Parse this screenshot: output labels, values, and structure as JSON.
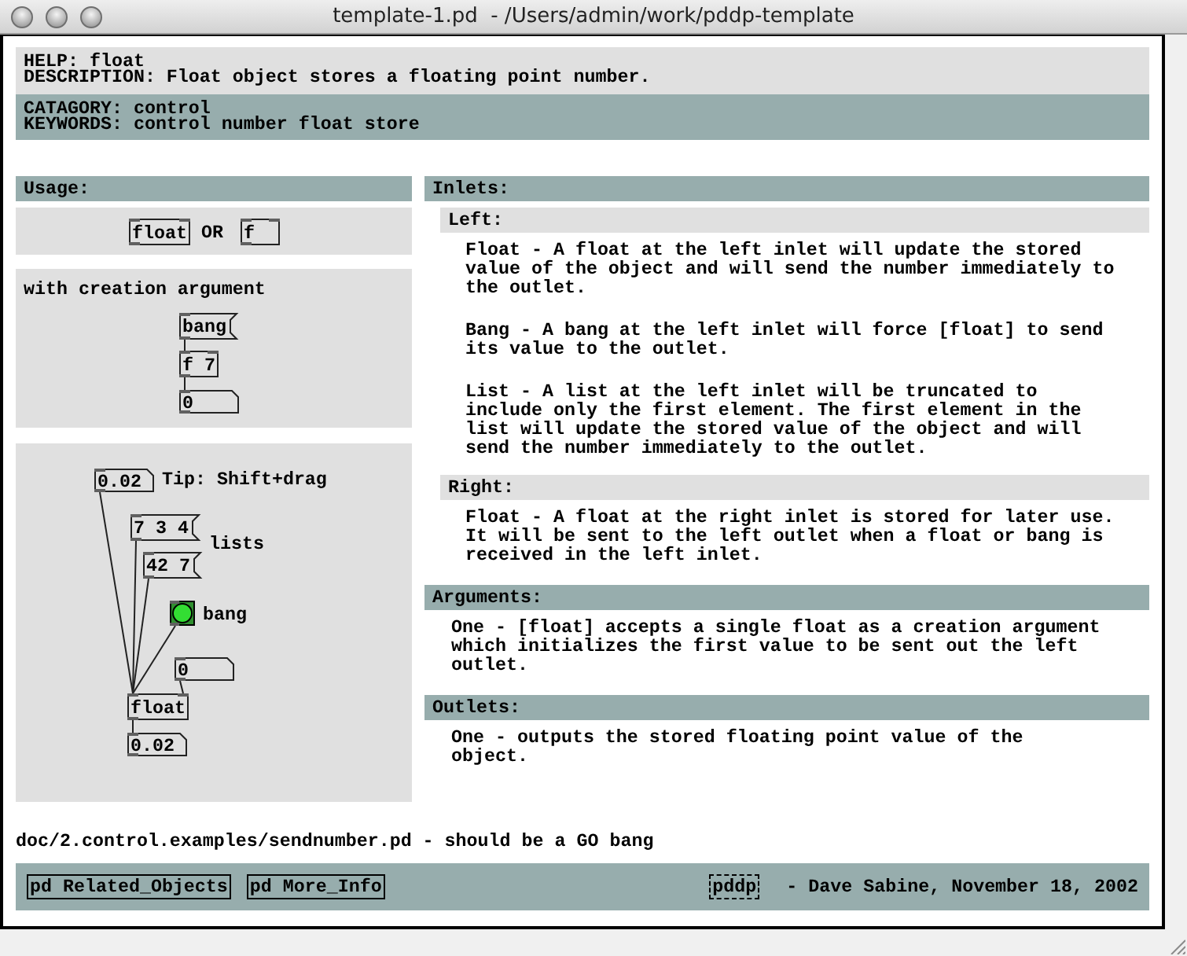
{
  "window": {
    "title": "template-1.pd  - /Users/admin/work/pddp-template"
  },
  "header": {
    "help": "HELP: float",
    "description": "DESCRIPTION: Float object stores a floating point number."
  },
  "category": {
    "category": "CATAGORY: control",
    "keywords": "KEYWORDS: control number float store"
  },
  "usage": {
    "title": "Usage:",
    "patches": [
      {
        "objects": [
          {
            "kind": "object",
            "text": "float"
          },
          {
            "kind": "comment",
            "text": "OR"
          },
          {
            "kind": "object",
            "text": "f"
          }
        ]
      },
      {
        "objects": [
          {
            "kind": "comment",
            "text": "with creation argument"
          },
          {
            "kind": "message",
            "text": "bang"
          },
          {
            "kind": "object",
            "text": "f 7"
          },
          {
            "kind": "number",
            "text": "0"
          }
        ]
      },
      {
        "objects": [
          {
            "kind": "number",
            "text": "0.02"
          },
          {
            "kind": "comment",
            "text": "Tip: Shift+drag"
          },
          {
            "kind": "message",
            "text": "7 3 4"
          },
          {
            "kind": "comment",
            "text": "lists"
          },
          {
            "kind": "message",
            "text": "42 7"
          },
          {
            "kind": "bang"
          },
          {
            "kind": "comment",
            "text": "bang"
          },
          {
            "kind": "number",
            "text": "0"
          },
          {
            "kind": "object",
            "text": "float"
          },
          {
            "kind": "number",
            "text": "0.02"
          }
        ]
      }
    ]
  },
  "inlets": {
    "title": "Inlets:",
    "groups": [
      {
        "title": "Left:",
        "paragraphs": [
          "Float - A float at the left inlet will update the stored value of the object and will send the number immediately to the outlet.",
          "Bang - A bang at the left inlet will force [float] to send its value to the outlet.",
          "List - A list at the left inlet will be truncated to include only the first element. The first element in the list will update the stored value of the object and will send the number immediately to the outlet."
        ]
      },
      {
        "title": "Right:",
        "paragraphs": [
          "Float - A float at the right inlet is stored for later use. It will be sent to the left outlet when a float or bang is received in the left inlet."
        ]
      }
    ]
  },
  "arguments": {
    "title": "Arguments:",
    "paragraphs": [
      "One - [float] accepts a single float as a creation argument which initializes the first value to be sent out the left outlet."
    ]
  },
  "outlets": {
    "title": "Outlets:",
    "paragraphs": [
      "One - outputs the stored floating point value of the object."
    ]
  },
  "note": "doc/2.control.examples/sendnumber.pd - should be a GO bang",
  "footer": {
    "objects": [
      {
        "text": "pd Related_Objects",
        "broken": false
      },
      {
        "text": "pd More_Info",
        "broken": false
      },
      {
        "text": "pddp",
        "broken": true
      }
    ],
    "credit": "- Dave Sabine, November 18, 2002"
  }
}
